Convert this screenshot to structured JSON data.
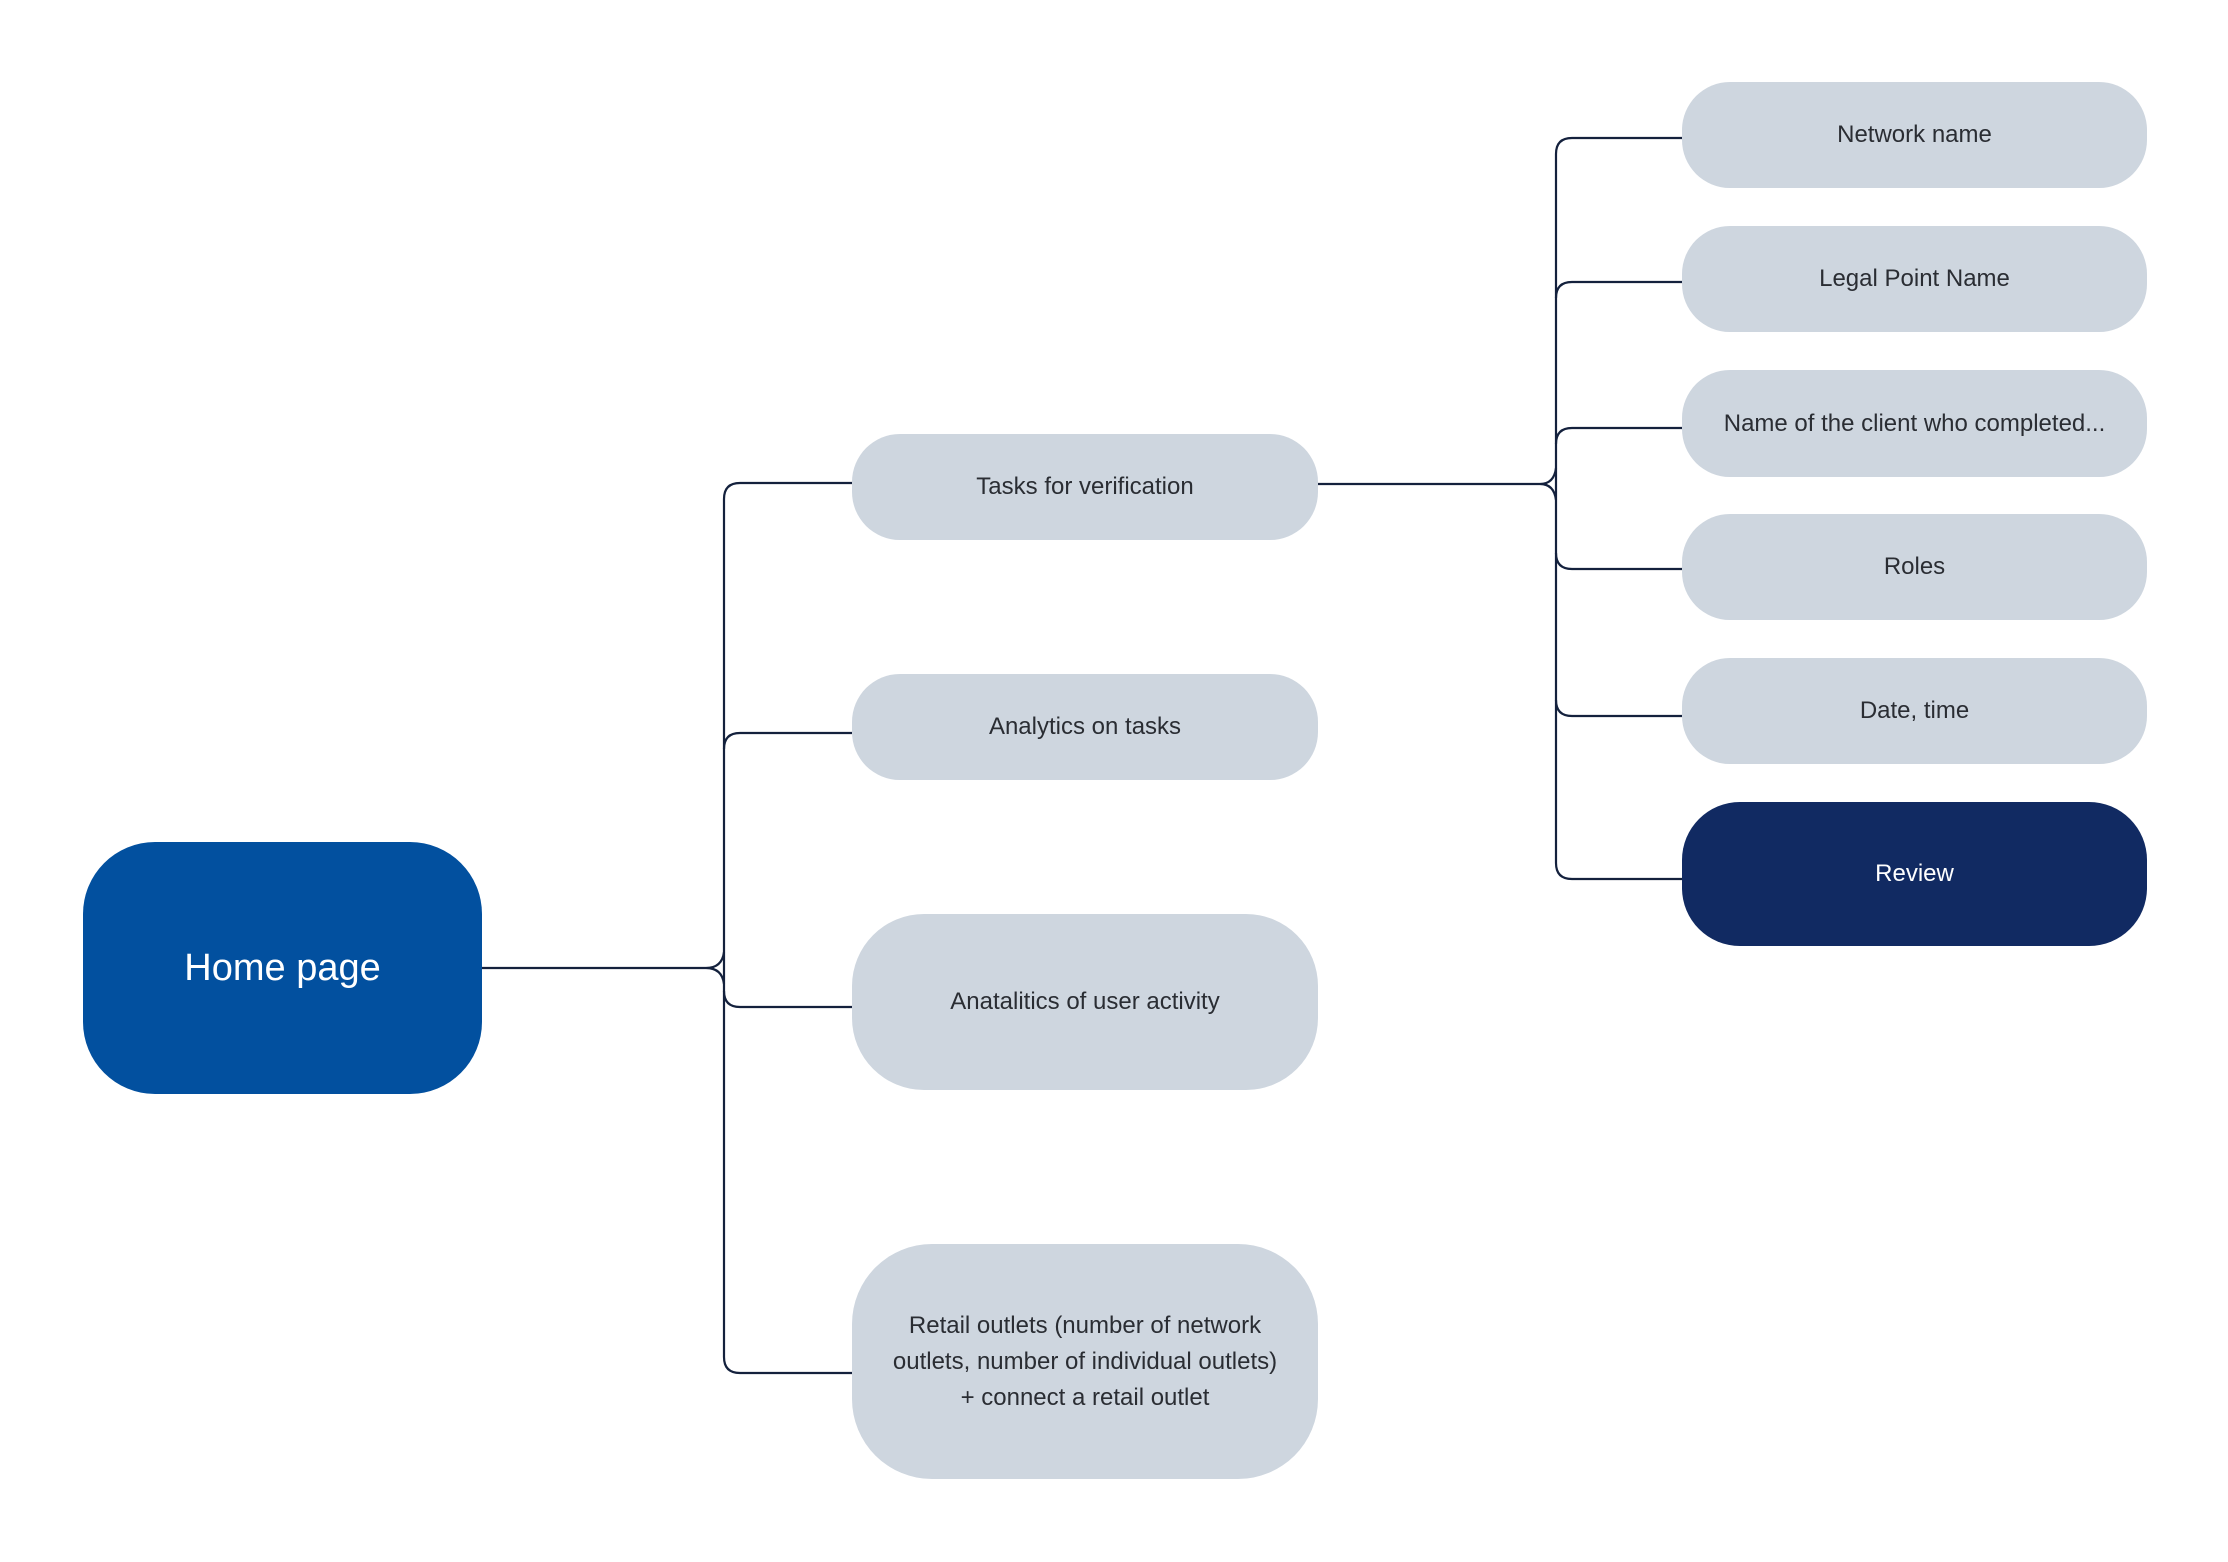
{
  "diagram": {
    "type": "mind-map",
    "colors": {
      "root": "#02509f",
      "node": "#ced6df",
      "highlight": "#112a62",
      "connector": "#14213d",
      "text": "#2a2d33"
    },
    "root": {
      "label": "Home page",
      "children": [
        {
          "label": "Tasks for verification",
          "children": [
            {
              "label": "Network name"
            },
            {
              "label": "Legal Point Name"
            },
            {
              "label": "Name of the client who completed..."
            },
            {
              "label": "Roles"
            },
            {
              "label": "Date, time"
            },
            {
              "label": "Review",
              "highlighted": true
            }
          ]
        },
        {
          "label": "Analytics on tasks"
        },
        {
          "label": "Anatalitics of user activity"
        },
        {
          "label": "Retail outlets (number of network outlets, number of individual outlets) + connect a retail outlet"
        }
      ]
    }
  }
}
